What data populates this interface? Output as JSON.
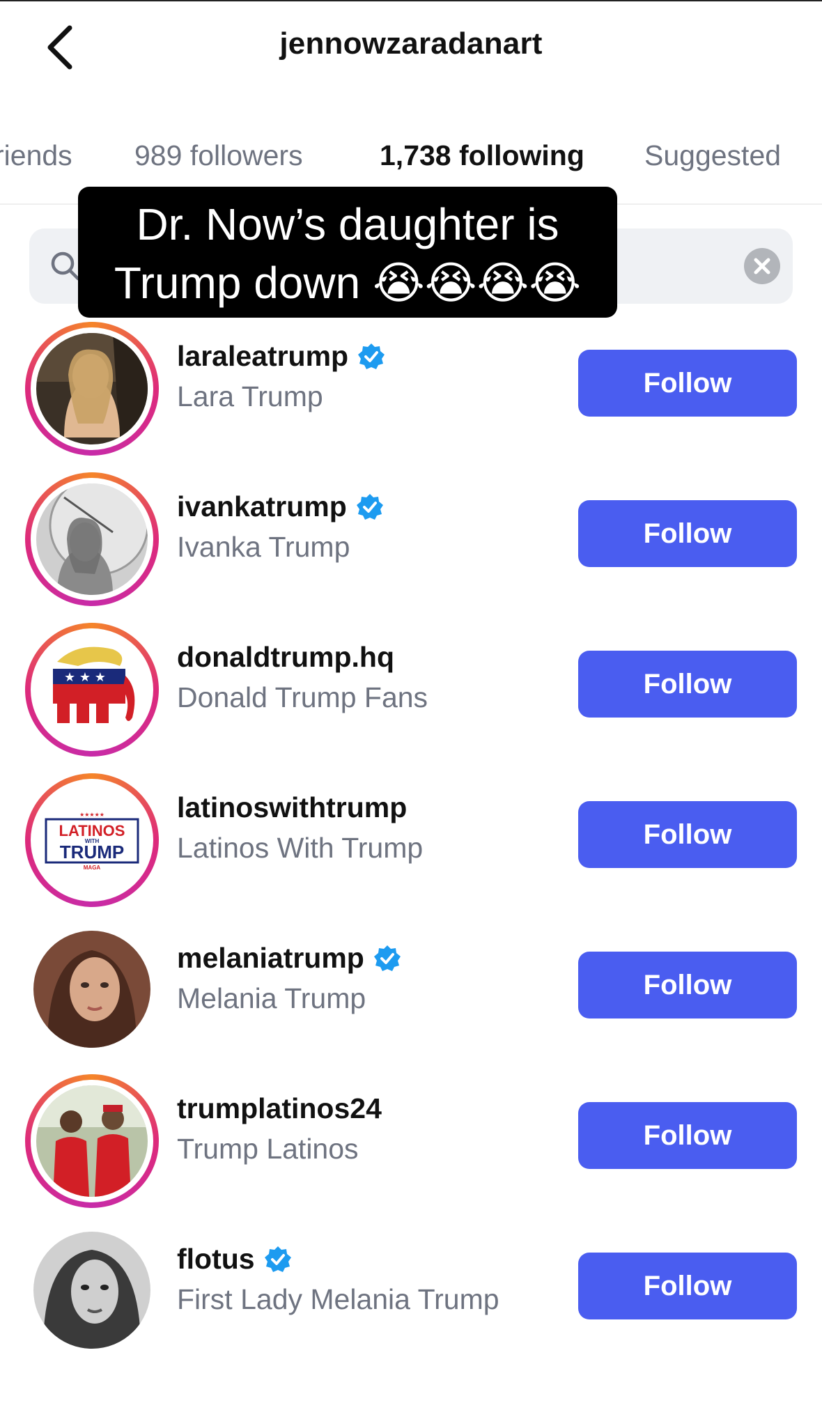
{
  "header": {
    "title": "jennowzaradanart",
    "back_icon": "chevron-left-icon"
  },
  "tabs": [
    {
      "label": "riends",
      "active": false
    },
    {
      "label": "989 followers",
      "active": false
    },
    {
      "label": "1,738 following",
      "active": true
    },
    {
      "label": "Suggested",
      "active": false
    }
  ],
  "search": {
    "value": "",
    "placeholder": "",
    "icon": "search-icon",
    "clear_icon": "clear-icon"
  },
  "caption": {
    "line1": "Dr. Now’s daughter is",
    "line2": "Trump down",
    "emoji": "😭😭😭😭"
  },
  "accounts": [
    {
      "username": "laraleatrump",
      "name": "Lara Trump",
      "verified": true,
      "ring": true,
      "button": "Follow"
    },
    {
      "username": "ivankatrump",
      "name": "Ivanka Trump",
      "verified": true,
      "ring": true,
      "button": "Follow"
    },
    {
      "username": "donaldtrump.hq",
      "name": "Donald Trump Fans",
      "verified": false,
      "ring": true,
      "button": "Follow"
    },
    {
      "username": "latinoswithtrump",
      "name": "Latinos With Trump",
      "verified": false,
      "ring": true,
      "button": "Follow",
      "avatar_text": {
        "top": "LATINOS",
        "mid": "WITH",
        "main": "TRUMP",
        "bottom": "MAGA"
      }
    },
    {
      "username": "melaniatrump",
      "name": "Melania Trump",
      "verified": true,
      "ring": false,
      "button": "Follow"
    },
    {
      "username": "trumplatinos24",
      "name": "Trump Latinos",
      "verified": false,
      "ring": true,
      "button": "Follow"
    },
    {
      "username": "flotus",
      "name": "First Lady Melania Trump",
      "verified": true,
      "ring": false,
      "button": "Follow"
    }
  ],
  "colors": {
    "follow_button": "#4a5df0",
    "verified_badge": "#1d9bf0",
    "secondary_text": "#6e7380"
  }
}
